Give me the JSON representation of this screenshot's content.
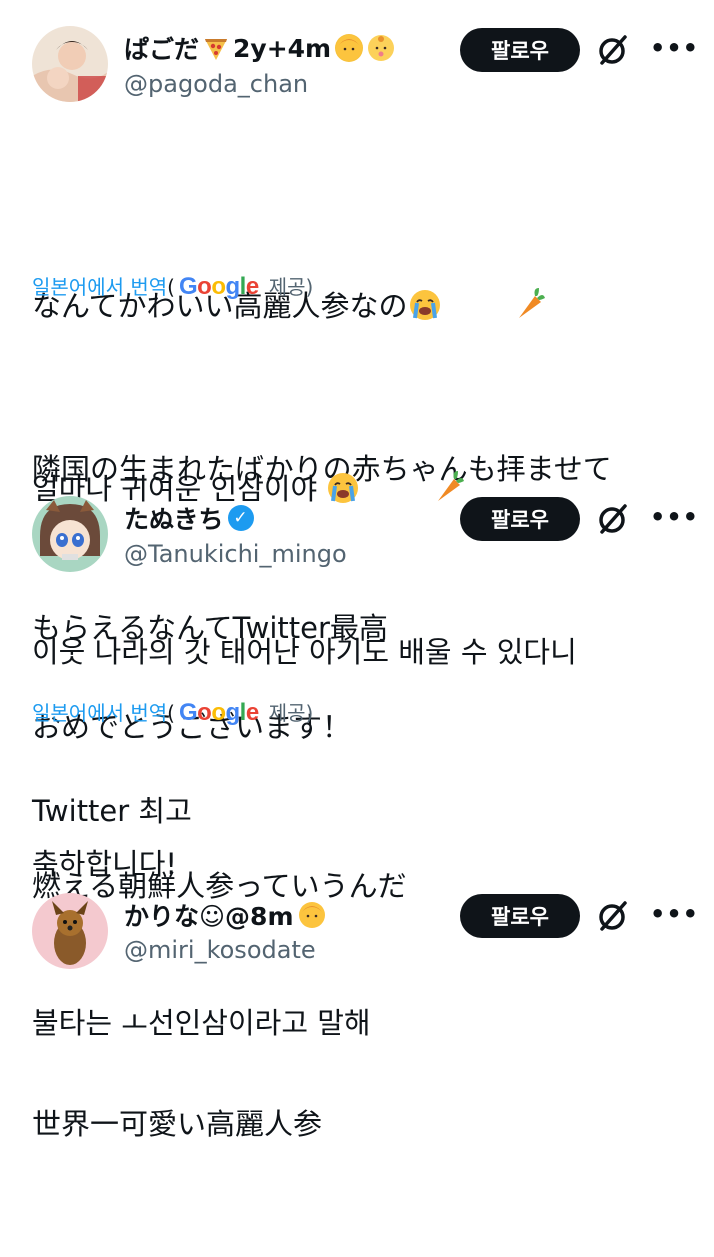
{
  "colors": {
    "link": "#1d9bf0",
    "secondary": "#536471",
    "button_bg": "#0f1419",
    "button_text": "#ffffff"
  },
  "translation": {
    "prefix": "일본어에서 번역",
    "open_paren": "(",
    "provider_logo": "Google",
    "provider_suffix": "제공)"
  },
  "tweets": [
    {
      "name": "ぱごだ",
      "name_suffix": "2y+4m",
      "handle": "@pagoda_chan",
      "follow_label": "팔로우",
      "original_lines": [
        "なんてかわいい高麗人参なの",
        "隣国の生まれたばかりの赤ちゃんも拝ませて",
        "もらえるなんてTwitter最高"
      ],
      "translated_lines": [
        "얼마나 귀여운 인삼이야",
        "이웃 나라의 갓 태어난 아기도 배울 수 있다니",
        "Twitter 최고"
      ],
      "icons": [
        "pizza-icon",
        "man-icon",
        "baby-icon",
        "crying-face-icon",
        "carrot-icon"
      ]
    },
    {
      "name": "たぬきち",
      "handle": "@Tanukichi_mingo",
      "follow_label": "팔로우",
      "verified": true,
      "original_lines": [
        "おめでとうございます！",
        "燃える朝鮮人参っていうんだ"
      ],
      "translated_lines": [
        "축하합니다!",
        "불타는 ㅗ선인삼이라고 말해"
      ]
    },
    {
      "name": "かりな☺@8m",
      "handle": "@miri_kosodate",
      "follow_label": "팔로우",
      "original_lines": [
        "世界一可愛い高麗人参"
      ],
      "icons": [
        "man-icon"
      ]
    }
  ]
}
